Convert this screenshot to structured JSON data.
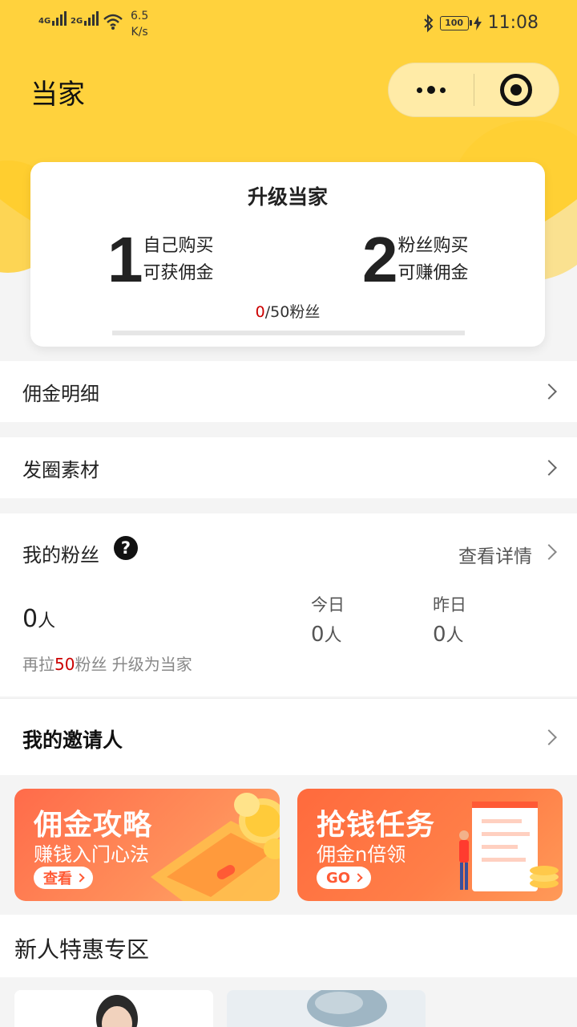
{
  "status_bar": {
    "sig1": "4G",
    "sig2": "2G",
    "net_speed_value": "6.5",
    "net_speed_unit": "K/s",
    "battery": "100",
    "time": "11:08"
  },
  "header": {
    "title": "当家"
  },
  "upgrade_card": {
    "title": "升级当家",
    "step1_num": "1",
    "step1_line1": "自己购买",
    "step1_line2": "可获佣金",
    "step2_num": "2",
    "step2_line1": "粉丝购买",
    "step2_line2": "可赚佣金",
    "progress_current": "0",
    "progress_rest": "/50粉丝",
    "progress_fraction": 0
  },
  "menu": {
    "commission_detail": "佣金明细",
    "post_material": "发圈素材"
  },
  "fans": {
    "title": "我的粉丝",
    "help_icon": "question-circle-icon",
    "view_details": "查看详情",
    "total_value": "0",
    "total_unit": "人",
    "today_label": "今日",
    "today_value": "0",
    "today_unit": "人",
    "yesterday_label": "昨日",
    "yesterday_value": "0",
    "yesterday_unit": "人",
    "hint_prefix": "再拉",
    "hint_number": "50",
    "hint_suffix": "粉丝 升级为当家"
  },
  "inviter": {
    "title": "我的邀请人"
  },
  "banners": [
    {
      "title": "佣金攻略",
      "subtitle": "赚钱入门心法",
      "button": "查看"
    },
    {
      "title": "抢钱任务",
      "subtitle": "佣金n倍领",
      "button": "GO"
    }
  ],
  "newcomer": {
    "title": "新人特惠专区"
  },
  "colors": {
    "accent": "#ffd23d",
    "highlight": "#cc0000",
    "banner": "#ff6b4a"
  }
}
